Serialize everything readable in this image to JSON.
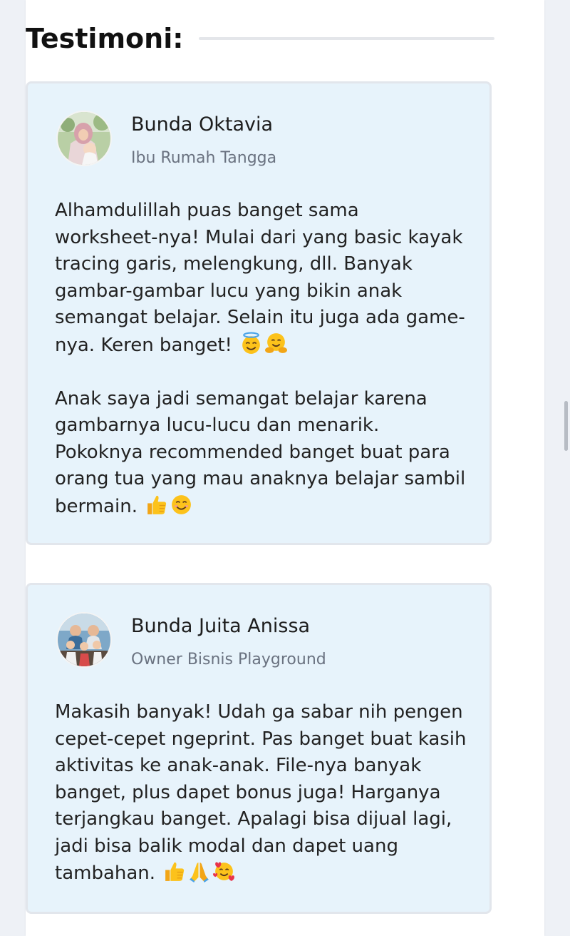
{
  "section": {
    "title": "Testimoni:"
  },
  "testimonials": [
    {
      "name": "Bunda Oktavia",
      "role": "Ibu Rumah Tangga",
      "paragraphs": [
        "Alhamdulillah puas banget sama\nworksheet-nya! Mulai dari yang basic kayak\ntracing garis, melengkung, dll. Banyak\ngambar-gambar lucu yang bikin anak\nsemangat belajar. Selain itu juga ada game-\nnya. Keren banget!",
        "Anak saya jadi semangat belajar karena\ngambarnya lucu-lucu dan menarik.\nPokoknya recommended banget buat para\norang tua yang mau anaknya belajar sambil\nbermain."
      ],
      "emojis": [
        [
          "smiling-face-with-halo",
          "hugging-face"
        ],
        [
          "thumbs-up",
          "smiling-face"
        ]
      ]
    },
    {
      "name": "Bunda Juita Anissa",
      "role": "Owner Bisnis Playground",
      "paragraphs": [
        "Makasih banyak! Udah ga sabar nih pengen\ncepet-cepet ngeprint. Pas banget buat kasih\naktivitas ke anak-anak. File-nya banyak\nbanget, plus dapet bonus juga! Harganya\nterjangkau banget. Apalagi bisa dijual lagi,\njadi bisa balik modal dan dapet uang\ntambahan."
      ],
      "emojis": [
        [
          "thumbs-up",
          "folded-hands",
          "smiling-face-with-hearts"
        ]
      ]
    }
  ],
  "colors": {
    "card_background": "#e7f3fb",
    "emoji_yellow": "#fcc21b",
    "heart_red": "#e8334a"
  }
}
